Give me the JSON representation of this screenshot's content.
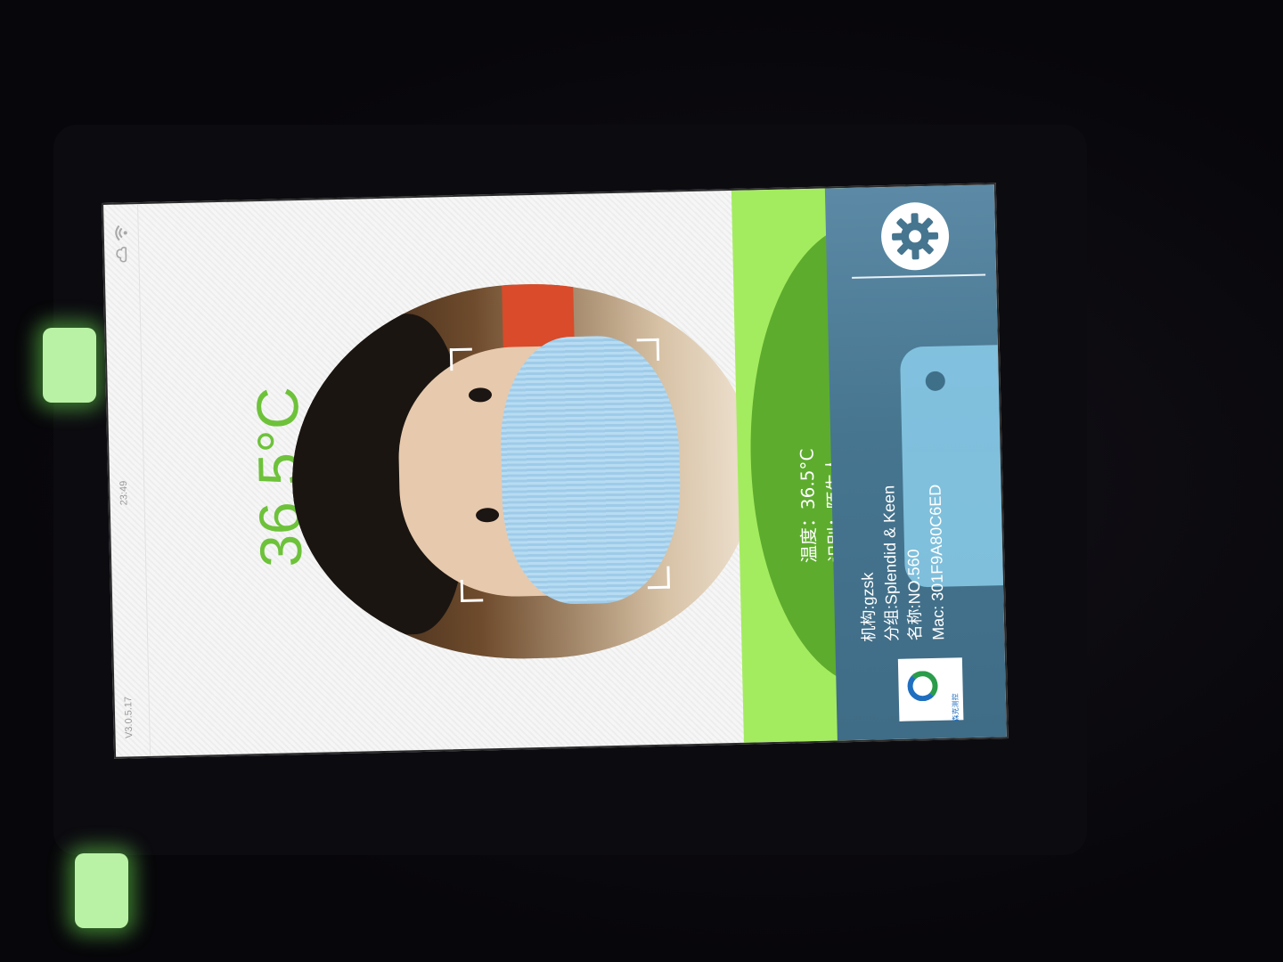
{
  "status": {
    "time": "23:49",
    "version": "V3.0.5.17",
    "icons": [
      "wifi-icon",
      "cloud-icon"
    ]
  },
  "main": {
    "temperature_display": "36.5°C"
  },
  "result": {
    "temperature_line": "温度：36.5°C",
    "recognition_line": "识别：陌生人"
  },
  "info": {
    "organization": "机构:gzsk",
    "group": "分组:Splendid & Keen",
    "name": "名称:NO.560",
    "mac": "Mac: 301F9A80C6ED"
  },
  "logo": {
    "text": "森克测控"
  },
  "colors": {
    "temperature_text": "#6dc23a",
    "result_panel_light": "#a4ec5f",
    "result_panel_dark": "#5dac2e",
    "info_panel": "#46758f"
  }
}
